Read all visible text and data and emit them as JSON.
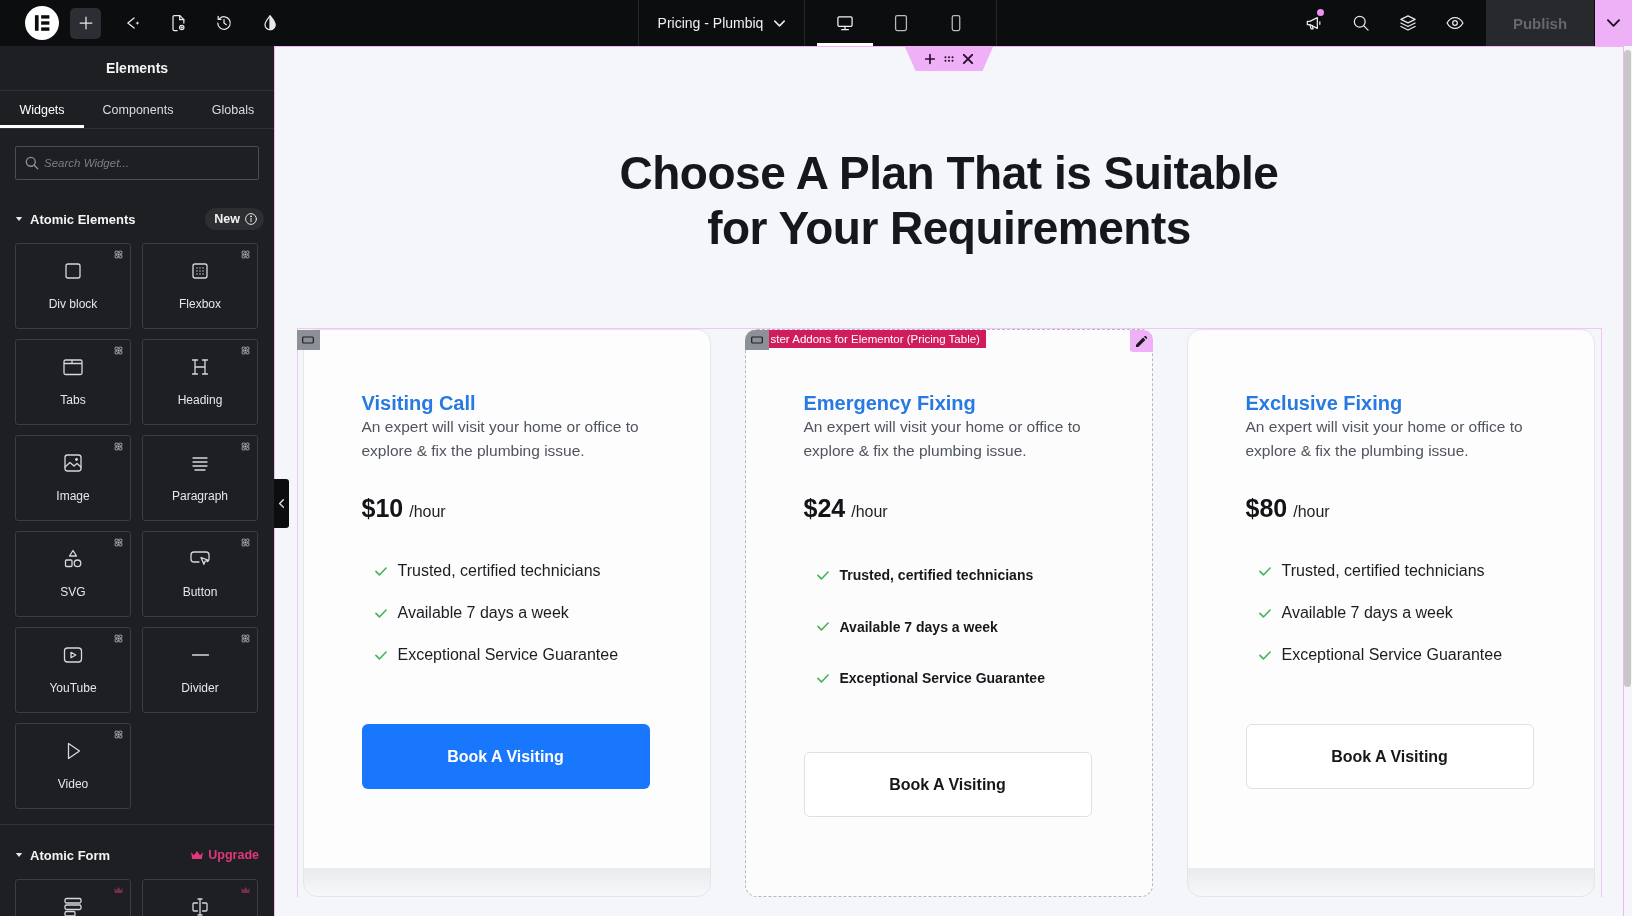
{
  "topbar": {
    "tools": [
      {
        "kind": "add",
        "selected": true
      },
      {
        "kind": "ai",
        "selected": false
      },
      {
        "kind": "page-settings",
        "selected": false
      },
      {
        "kind": "history",
        "selected": false
      },
      {
        "kind": "theme",
        "selected": false
      }
    ],
    "document_title": "Pricing - Plumbiq",
    "devices": [
      {
        "kind": "desktop",
        "selected": true
      },
      {
        "kind": "tablet",
        "selected": false
      },
      {
        "kind": "mobile",
        "selected": false
      }
    ],
    "actions": [
      {
        "kind": "announcements",
        "notification": true
      },
      {
        "kind": "search",
        "notification": false
      },
      {
        "kind": "structure",
        "notification": false
      },
      {
        "kind": "preview",
        "notification": false
      }
    ],
    "publish": {
      "label": "Publish",
      "disabled": true
    }
  },
  "sidebar": {
    "title": "Elements",
    "tabs": [
      {
        "label": "Widgets",
        "selected": true
      },
      {
        "label": "Components",
        "selected": false
      },
      {
        "label": "Globals",
        "selected": false
      }
    ],
    "search": {
      "placeholder": "Search Widget..."
    },
    "sections": [
      {
        "title": "Atomic Elements",
        "expanded": true,
        "badge": {
          "kind": "new",
          "label": "New"
        },
        "widgets": [
          {
            "kind": "div-block",
            "label": "Div block",
            "locked": false
          },
          {
            "kind": "flexbox",
            "label": "Flexbox",
            "locked": false
          },
          {
            "kind": "tabs",
            "label": "Tabs",
            "locked": false
          },
          {
            "kind": "heading",
            "label": "Heading",
            "locked": false
          },
          {
            "kind": "image",
            "label": "Image",
            "locked": false
          },
          {
            "kind": "paragraph",
            "label": "Paragraph",
            "locked": false
          },
          {
            "kind": "svg",
            "label": "SVG",
            "locked": false
          },
          {
            "kind": "button",
            "label": "Button",
            "locked": false
          },
          {
            "kind": "youtube",
            "label": "YouTube",
            "locked": false
          },
          {
            "kind": "divider",
            "label": "Divider",
            "locked": false
          },
          {
            "kind": "video",
            "label": "Video",
            "locked": false
          }
        ]
      },
      {
        "title": "Atomic Form",
        "expanded": true,
        "badge": {
          "kind": "upgrade",
          "label": "Upgrade"
        },
        "widgets": [
          {
            "kind": "form",
            "locked": true
          },
          {
            "kind": "input",
            "locked": true
          }
        ]
      }
    ]
  },
  "canvas": {
    "heading": "Choose A Plan That is Suitable for Your Requirements",
    "plans": [
      {
        "title": "Visiting Call",
        "description": "An expert will visit your home or office to explore & fix the plumbing issue.",
        "price": "$10",
        "period": "/hour",
        "features": [
          "Trusted, certified technicians",
          "Available 7 days a week",
          "Exceptional Service Guarantee"
        ],
        "button": "Book A Visiting",
        "selected": false
      },
      {
        "title": "Emergency Fixing",
        "description": "An expert will visit your home or office to explore & fix the plumbing issue.",
        "price": "$24",
        "period": "/hour",
        "features": [
          "Trusted, certified technicians",
          "Available 7 days a week",
          "Exceptional Service Guarantee"
        ],
        "button": "Book A Visiting",
        "selected": true,
        "widget_label": "ster Addons for Elementor (Pricing Table)"
      },
      {
        "title": "Exclusive Fixing",
        "description": "An expert will visit your home or office to explore & fix the plumbing issue.",
        "price": "$80",
        "period": "/hour",
        "features": [
          "Trusted, certified technicians",
          "Available 7 days a week",
          "Exceptional Service Guarantee"
        ],
        "button": "Book A Visiting",
        "selected": false
      }
    ]
  }
}
